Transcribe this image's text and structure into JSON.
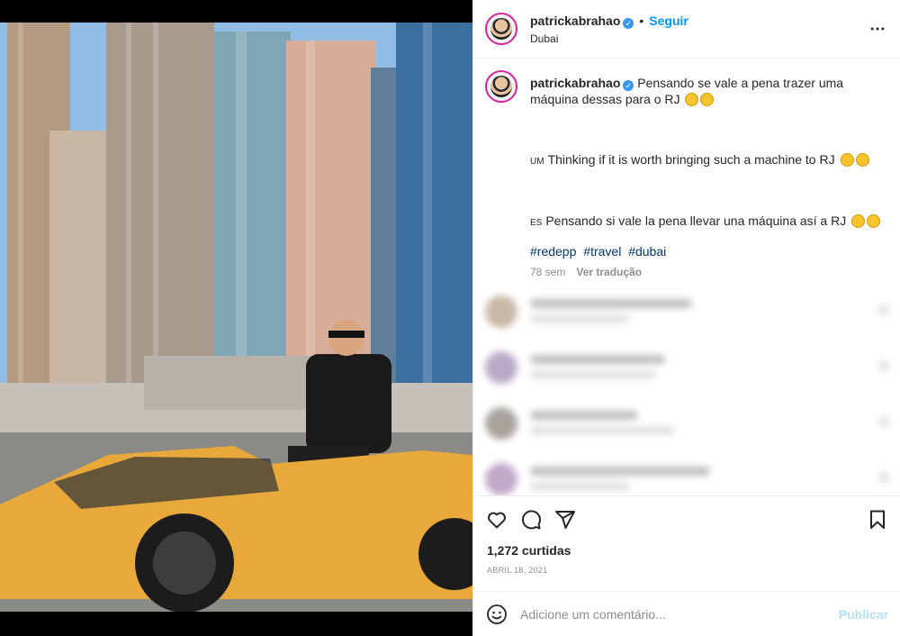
{
  "post": {
    "username": "patrickabrahao",
    "verified_mark": "✓",
    "follow_label": "Seguir",
    "separator": "•",
    "location": "Dubai",
    "caption_text": "Pensando se vale a pena trazer uma máquina dessas para o RJ",
    "translations": [
      {
        "lang": "UM",
        "text": "Thinking if it is worth bringing such a machine to RJ"
      },
      {
        "lang": "ES",
        "text": "Pensando si vale la pena llevar una máquina así a RJ"
      }
    ],
    "hashtags": [
      "#redepp",
      "#travel",
      "#dubai"
    ],
    "age": "78 sem",
    "see_translation_label": "Ver tradução",
    "likes_text": "1,272 curtidas",
    "date_text": "ABRIL 18, 2021"
  },
  "comment_box": {
    "placeholder": "Adicione um comentário...",
    "publish_label": "Publicar"
  },
  "icons": {
    "more": "more-options-icon",
    "like": "heart-icon",
    "comment": "comment-bubble-icon",
    "share": "paper-plane-icon",
    "save": "bookmark-icon",
    "emoji": "smile-icon"
  },
  "colors": {
    "link_blue": "#0095f6",
    "hashtag": "#00376b",
    "muted": "#8e8e8e",
    "publish_disabled": "#b2dffc",
    "car_yellow": "#e8a93a"
  }
}
